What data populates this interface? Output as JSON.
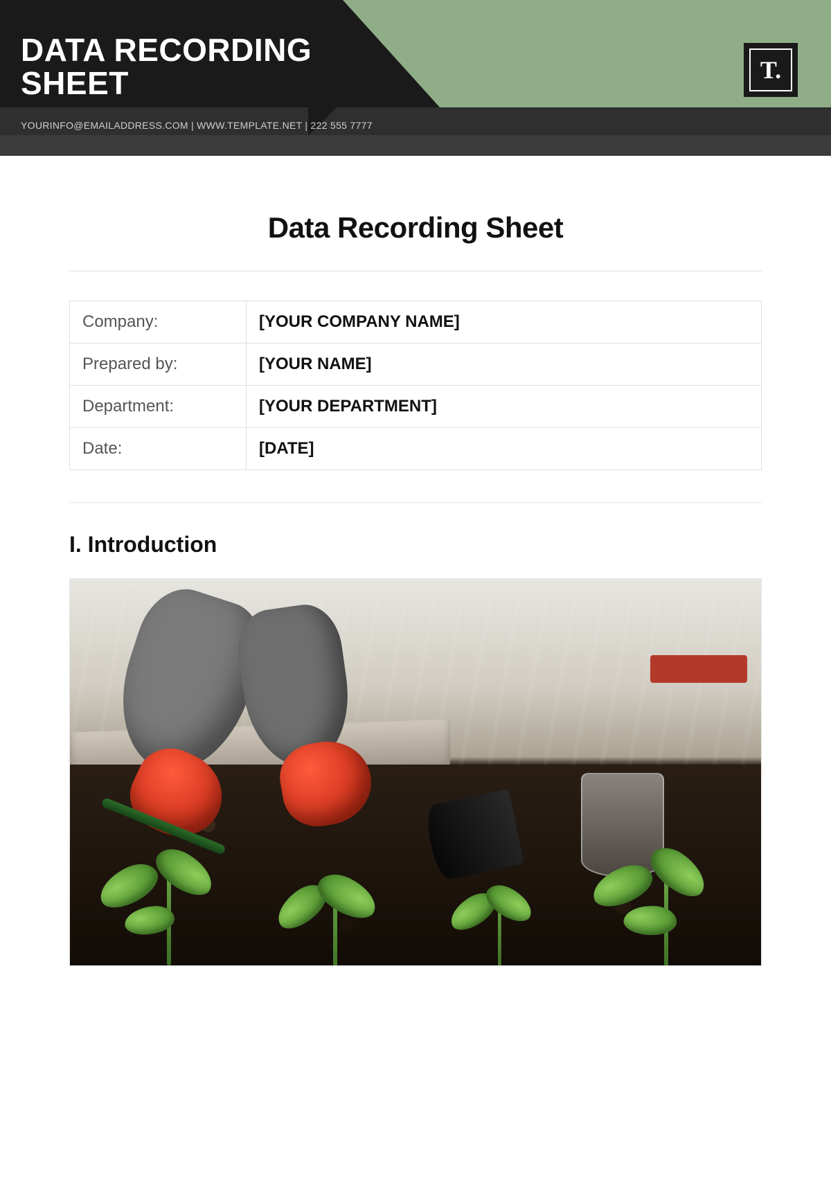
{
  "banner": {
    "title": "DATA RECORDING SHEET",
    "contact": "YOURINFO@EMAILADDRESS.COM | WWW.TEMPLATE.NET | 222 555 7777",
    "logo_text": "T."
  },
  "document": {
    "title": "Data Recording Sheet"
  },
  "info_table": {
    "rows": [
      {
        "label": "Company:",
        "value": "[YOUR COMPANY NAME]"
      },
      {
        "label": "Prepared by:",
        "value": "[YOUR NAME]"
      },
      {
        "label": "Department:",
        "value": "[YOUR DEPARTMENT]"
      },
      {
        "label": "Date:",
        "value": "[DATE]"
      }
    ]
  },
  "sections": {
    "introduction_heading": "I. Introduction"
  }
}
